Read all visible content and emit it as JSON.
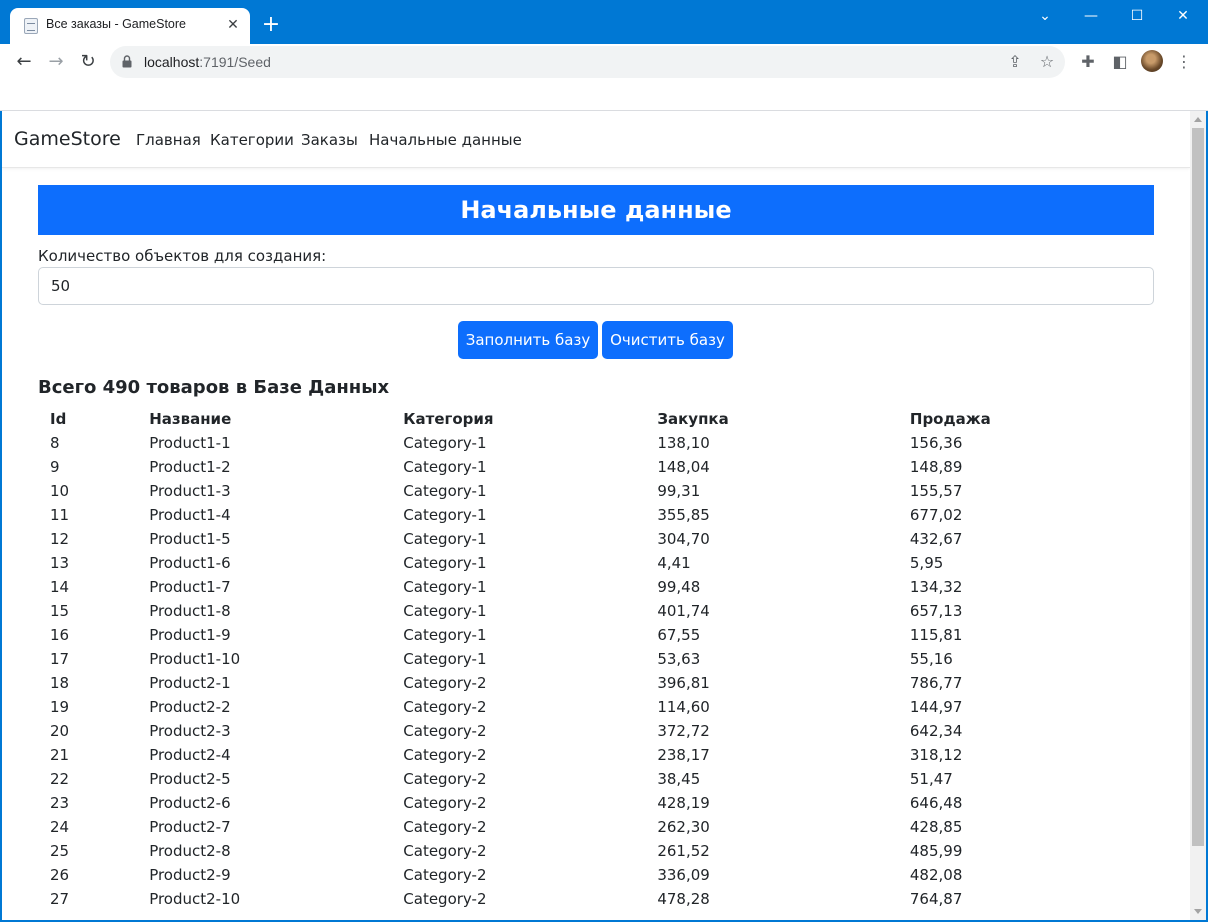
{
  "browser": {
    "tab_title": "Все заказы - GameStore",
    "url_host": "localhost",
    "url_rest": ":7191/Seed"
  },
  "navbar": {
    "brand": "GameStore",
    "links": [
      "Главная",
      "Категории",
      "Заказы",
      "Начальные данные"
    ]
  },
  "page": {
    "heading": "Начальные данные",
    "count_label": "Количество объектов для создания:",
    "count_value": "50",
    "fill_button": "Заполнить базу",
    "clear_button": "Очистить базу",
    "summary": "Всего 490 товаров в Базе Данных"
  },
  "table": {
    "headers": [
      "Id",
      "Название",
      "Категория",
      "Закупка",
      "Продажа"
    ],
    "rows": [
      [
        "8",
        "Product1-1",
        "Category-1",
        "138,10",
        "156,36"
      ],
      [
        "9",
        "Product1-2",
        "Category-1",
        "148,04",
        "148,89"
      ],
      [
        "10",
        "Product1-3",
        "Category-1",
        "99,31",
        "155,57"
      ],
      [
        "11",
        "Product1-4",
        "Category-1",
        "355,85",
        "677,02"
      ],
      [
        "12",
        "Product1-5",
        "Category-1",
        "304,70",
        "432,67"
      ],
      [
        "13",
        "Product1-6",
        "Category-1",
        "4,41",
        "5,95"
      ],
      [
        "14",
        "Product1-7",
        "Category-1",
        "99,48",
        "134,32"
      ],
      [
        "15",
        "Product1-8",
        "Category-1",
        "401,74",
        "657,13"
      ],
      [
        "16",
        "Product1-9",
        "Category-1",
        "67,55",
        "115,81"
      ],
      [
        "17",
        "Product1-10",
        "Category-1",
        "53,63",
        "55,16"
      ],
      [
        "18",
        "Product2-1",
        "Category-2",
        "396,81",
        "786,77"
      ],
      [
        "19",
        "Product2-2",
        "Category-2",
        "114,60",
        "144,97"
      ],
      [
        "20",
        "Product2-3",
        "Category-2",
        "372,72",
        "642,34"
      ],
      [
        "21",
        "Product2-4",
        "Category-2",
        "238,17",
        "318,12"
      ],
      [
        "22",
        "Product2-5",
        "Category-2",
        "38,45",
        "51,47"
      ],
      [
        "23",
        "Product2-6",
        "Category-2",
        "428,19",
        "646,48"
      ],
      [
        "24",
        "Product2-7",
        "Category-2",
        "262,30",
        "428,85"
      ],
      [
        "25",
        "Product2-8",
        "Category-2",
        "261,52",
        "485,99"
      ],
      [
        "26",
        "Product2-9",
        "Category-2",
        "336,09",
        "482,08"
      ],
      [
        "27",
        "Product2-10",
        "Category-2",
        "478,28",
        "764,87"
      ]
    ]
  },
  "colors": {
    "primary": "#0d6efd",
    "titlebar": "#0078d4"
  }
}
